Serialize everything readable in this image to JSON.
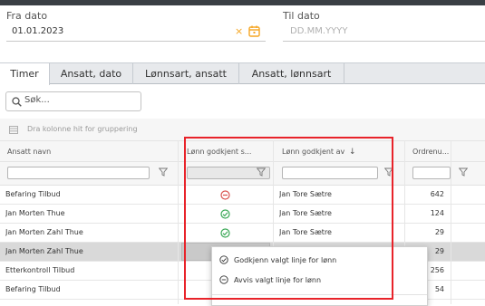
{
  "filters": {
    "from_label": "Fra dato",
    "from_value": "01.01.2023",
    "to_label": "Til dato",
    "to_placeholder": "DD.MM.YYYY"
  },
  "tabs": [
    {
      "label": "Timer",
      "active": true
    },
    {
      "label": "Ansatt, dato",
      "active": false
    },
    {
      "label": "Lønnsart, ansatt",
      "active": false
    },
    {
      "label": "Ansatt, lønnsart",
      "active": false
    }
  ],
  "search": {
    "placeholder": "Søk..."
  },
  "grouping": {
    "text": "Dra kolonne hit for gruppering"
  },
  "columns": {
    "employee": "Ansatt navn",
    "approved": "Lønn godkjent s...",
    "approved_by": "Lønn godkjent av",
    "order": "Ordrenu..."
  },
  "rows": [
    {
      "employee": "Befaring Tilbud",
      "status": "rejected",
      "approved_by": "Jan Tore Sætre",
      "order": "642"
    },
    {
      "employee": "Jan Morten Thue",
      "status": "approved",
      "approved_by": "Jan Tore Sætre",
      "order": "124"
    },
    {
      "employee": "Jan Morten Zahl Thue",
      "status": "approved",
      "approved_by": "Jan Tore Sætre",
      "order": "29"
    },
    {
      "employee": "Jan Morten Zahl Thue",
      "status": "",
      "approved_by": "",
      "order": "29"
    },
    {
      "employee": "Etterkontroll Tilbud",
      "status": "",
      "approved_by": "",
      "order": "256"
    },
    {
      "employee": "Befaring Tilbud",
      "status": "",
      "approved_by": "",
      "order": "54"
    }
  ],
  "context_menu": {
    "approve": "Godkjenn valgt linje for lønn",
    "reject": "Avvis valgt linje for lønn"
  },
  "colors": {
    "accent": "#f5a623",
    "approved": "#3aa856",
    "rejected": "#d9534f",
    "highlight": "#e8232a"
  }
}
